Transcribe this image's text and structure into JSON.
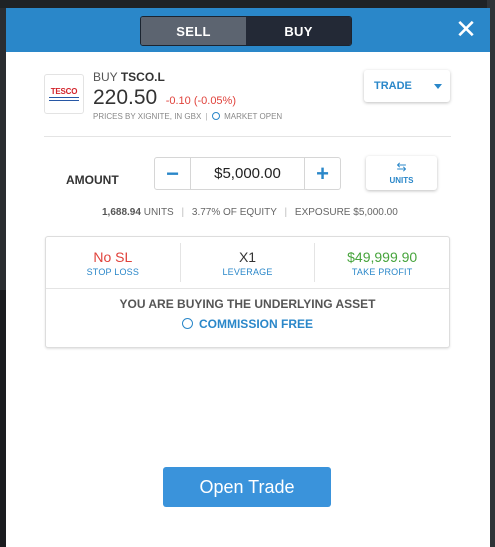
{
  "header": {
    "sell_label": "SELL",
    "buy_label": "BUY",
    "close_symbol": "✕"
  },
  "instrument": {
    "logo_text": "TESCO",
    "action": "BUY",
    "symbol": "TSCO.L",
    "price": "220.50",
    "change": "-0.10 (-0.05%)",
    "price_source": "PRICES BY XIGNITE, IN GBX",
    "market_status": "MARKET OPEN"
  },
  "trade_dropdown": {
    "label": "TRADE"
  },
  "amount": {
    "label": "AMOUNT",
    "value": "$5,000.00",
    "minus": "−",
    "plus": "+",
    "units_label": "UNITS",
    "units_icon": "⇆"
  },
  "amount_info": {
    "units_value": "1,688.94",
    "units_word": "UNITS",
    "equity": "3.77% OF EQUITY",
    "exposure_label": "EXPOSURE",
    "exposure_value": "$5,000.00"
  },
  "order": {
    "stop_loss_value": "No SL",
    "stop_loss_label": "STOP LOSS",
    "leverage_value": "X1",
    "leverage_label": "LEVERAGE",
    "take_profit_value": "$49,999.90",
    "take_profit_label": "TAKE PROFIT",
    "message": "YOU ARE BUYING THE UNDERLYING ASSET",
    "commission": "COMMISSION FREE"
  },
  "open_button": {
    "label": "Open Trade"
  },
  "colors": {
    "header_blue": "#2a87c9",
    "sell_active": "#5c6470",
    "buy_inactive": "#232936",
    "negative_red": "#e0423b",
    "positive_green": "#47a43c",
    "button_blue": "#3a93db"
  }
}
